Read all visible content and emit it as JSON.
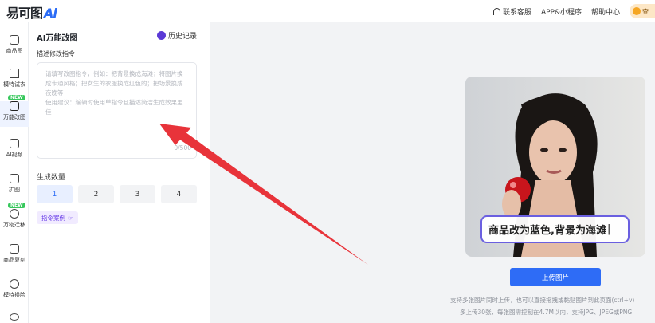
{
  "topbar": {
    "logo_text": "易可图",
    "logo_ai": "Ai",
    "customer_service": "联系客服",
    "app": "APP&小程序",
    "help": "帮助中心",
    "user_text": "查"
  },
  "nav": {
    "new_badge": "NEW",
    "items": [
      {
        "label": "商品图"
      },
      {
        "label": "模特试衣"
      },
      {
        "label": "万能改图"
      },
      {
        "label": "AI视频"
      },
      {
        "label": "扩图"
      },
      {
        "label": "万物迁移"
      },
      {
        "label": "商品复刻"
      },
      {
        "label": "模特换脸"
      }
    ]
  },
  "panel": {
    "title": "AI万能改图",
    "history": "历史记录",
    "prompt_label": "描述修改指令",
    "prompt_placeholder_1": "请填写改图指令，例如：把背景换成海滩；将图片换成卡通风格；把女生的衣服换成红色的；把场景换成夜晚等",
    "prompt_placeholder_2": "使用建议：编辑时使用单指令且描述简洁生成效果更佳",
    "prompt_value": "",
    "counter": "0/500",
    "count_label": "生成数量",
    "counts": [
      "1",
      "2",
      "3",
      "4"
    ],
    "selected_count": "1",
    "example_chip": "指令案例"
  },
  "main": {
    "overlay_text": "商品改为蓝色,背景为海滩",
    "upload_button": "上传图片",
    "hint_line1": "支持多张图片同时上传，也可以直接拖拽或黏贴图片到此页面(ctrl+v)",
    "hint_line2": "多上传30张，每张图需控制在4.7M以内，支持JPG、JPEG或PNG"
  },
  "colors": {
    "accent": "#2e6cf6",
    "new_badge": "#37c85c",
    "arrow": "#e8333a",
    "overlay_border": "#6a5fe0"
  }
}
